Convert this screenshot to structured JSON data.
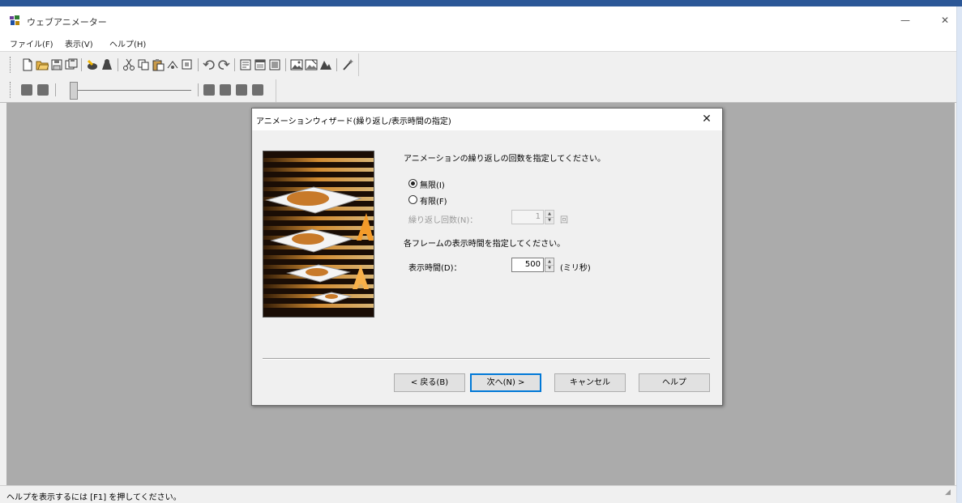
{
  "window": {
    "title": "ウェブアニメーター",
    "minimize": "—",
    "close": "✕"
  },
  "menu": [
    {
      "label": "ファイル(F)"
    },
    {
      "label": "表示(V)"
    },
    {
      "label": "ヘルプ(H)"
    }
  ],
  "toolbar_icons": [
    "new-icon",
    "open-icon",
    "save-icon",
    "save-as-icon",
    "import-icon",
    "export-icon",
    "cut-icon",
    "copy-icon",
    "paste-icon",
    "delete-icon",
    "duplicate-icon",
    "undo-icon",
    "redo-icon",
    "frame-props-icon",
    "frame-list-icon",
    "frame-insert-icon",
    "image-icon",
    "image-edit-icon",
    "effect-icon",
    "wand-icon"
  ],
  "playback_icons": [
    "first-frame-icon",
    "previous-frame-icon",
    "play-icon",
    "stop-icon",
    "next-frame-icon",
    "last-frame-icon"
  ],
  "dialog": {
    "title": "アニメーションウィザード(繰り返し/表示時間の指定)",
    "close": "✕",
    "loop_prompt": "アニメーションの繰り返しの回数を指定してください。",
    "radio_infinite": "無限(I)",
    "radio_finite": "有限(F)",
    "repeat_label": "繰り返し回数(N)：",
    "repeat_value": "1",
    "repeat_unit": "回",
    "frame_prompt": "各フレームの表示時間を指定してください。",
    "display_label": "表示時間(D)：",
    "display_value": "500",
    "display_unit": "(ミリ秒)",
    "buttons": {
      "back": "< 戻る(B)",
      "next": "次へ(N) >",
      "cancel": "キャンセル",
      "help": "ヘルプ"
    }
  },
  "status": {
    "text": "ヘルプを表示するには [F1] を押してください。"
  },
  "colors": {
    "titlebar_accent": "#2b5797",
    "workspace": "#ababab",
    "default_button_border": "#0078d7",
    "wizard_orange": "#f5a623"
  }
}
